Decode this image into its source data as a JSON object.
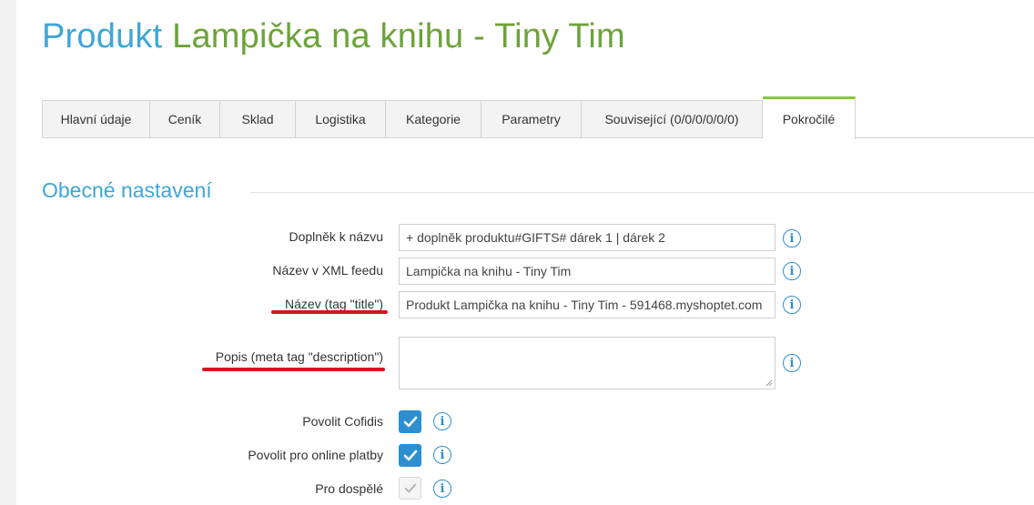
{
  "title": {
    "prefix": "Produkt",
    "name": "Lampička na knihu - Tiny Tim"
  },
  "tabs": [
    {
      "label": "Hlavní údaje"
    },
    {
      "label": "Ceník"
    },
    {
      "label": "Sklad"
    },
    {
      "label": "Logistika"
    },
    {
      "label": "Kategorie"
    },
    {
      "label": "Parametry"
    },
    {
      "label": "Související (0/0/0/0/0/0)"
    },
    {
      "label": "Pokročilé",
      "active": true
    }
  ],
  "section": {
    "title": "Obecné nastavení"
  },
  "fields": {
    "name_addon": {
      "label": "Doplněk k názvu",
      "value": "+ doplněk produktu#GIFTS# dárek 1 | dárek 2"
    },
    "xml_feed_name": {
      "label": "Název v XML feedu",
      "value": "Lampička na knihu - Tiny Tim"
    },
    "title_tag": {
      "label": "Název (tag \"title\")",
      "value": "Produkt  Lampička na knihu - Tiny Tim  - 591468.myshoptet.com"
    },
    "meta_description": {
      "label": "Popis (meta tag \"description\")",
      "value": ""
    }
  },
  "checkboxes": {
    "cofidis": {
      "label": "Povolit Cofidis",
      "checked": true
    },
    "online_payments": {
      "label": "Povolit pro online platby",
      "checked": true
    },
    "adults": {
      "label": "Pro dospělé",
      "checked": true,
      "disabled": true
    }
  },
  "icons": {
    "info": "info-circle-icon",
    "check": "checkmark-icon",
    "resize": "resize-grip-icon"
  },
  "colors": {
    "title_prefix": "#3ea6d8",
    "title_name": "#6da33b",
    "active_tab_accent": "#8cc63e",
    "section_title": "#3ea6d8",
    "info_icon": "#2d8fd0",
    "checkbox_checked": "#2d8fd0",
    "annotation_underline": "#d4161e"
  }
}
